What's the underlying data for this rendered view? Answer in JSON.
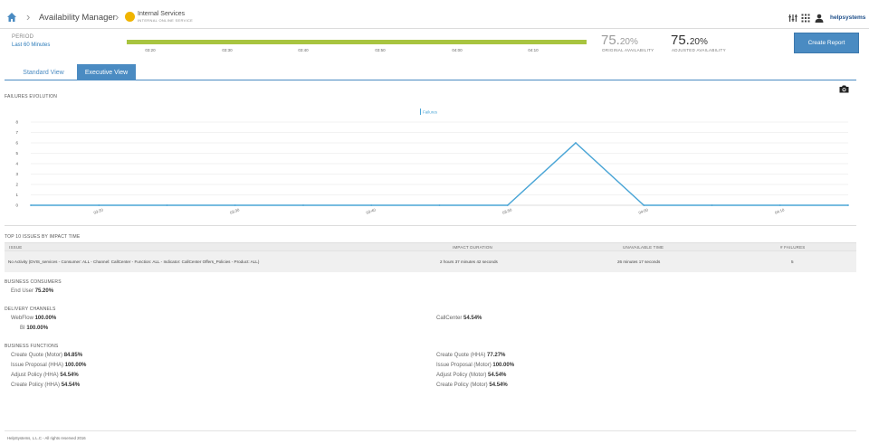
{
  "header": {
    "app_title": "Availability Manager",
    "service_title": "Internal Services",
    "service_subtitle": "INTERNAL ONLINE SERVICE",
    "brand": "helpsystems"
  },
  "period": {
    "label": "PERIOD",
    "value": "Last 60 Minutes",
    "ticks": [
      "03:20",
      "03:30",
      "03:40",
      "03:50",
      "04:00",
      "04:10"
    ]
  },
  "availability": {
    "original_value": "75.",
    "original_decimals": "20%",
    "original_label": "ORIGINAL AVAILABILITY",
    "adjusted_value": "75.",
    "adjusted_decimals": "20%",
    "adjusted_label": "ADJUSTED AVAILABILITY"
  },
  "buttons": {
    "create_report": "Create Report"
  },
  "tabs": [
    {
      "label": "Standard View",
      "active": false
    },
    {
      "label": "Executive View",
      "active": true
    }
  ],
  "sections": {
    "failures_evolution": "FAILURES EVOLUTION",
    "top_issues": "TOP 10 ISSUES BY IMPACT TIME",
    "business_consumers": "BUSINESS CONSUMERS",
    "delivery_channels": "DELIVERY CHANNELS",
    "business_functions": "BUSINESS FUNCTIONS"
  },
  "chart_data": {
    "type": "line",
    "legend": "Failures",
    "x": [
      "03:15",
      "03:20",
      "03:25",
      "03:30",
      "03:35",
      "03:40",
      "03:45",
      "03:50",
      "03:55",
      "04:00",
      "04:05",
      "04:10",
      "04:15"
    ],
    "x_tick_labels": [
      "03:20",
      "03:30",
      "03:40",
      "03:50",
      "04:00",
      "04:10"
    ],
    "series": [
      {
        "name": "Failures",
        "values": [
          0,
          0,
          0,
          0,
          0,
          0,
          0,
          0,
          6,
          0,
          0,
          0,
          0
        ]
      }
    ],
    "ylim": [
      0,
      8
    ],
    "y_ticks": [
      0,
      1,
      2,
      3,
      4,
      5,
      6,
      7,
      8
    ],
    "color": "#4aa5d6",
    "grid": true,
    "legend_position": "top-center"
  },
  "issues_table": {
    "columns": [
      "ISSUE",
      "IMPACT DURATION",
      "UNAVAILABLE TIME",
      "# FAILURES"
    ],
    "rows": [
      {
        "issue": "No Activity (DVIS_services - Consumer: ALL - Channel: CallCenter - Function: ALL - Indicator: CallCenter Offers_Policies - Product: ALL)",
        "impact_duration": "2 hours 37 minutes 42 seconds",
        "unavailable_time": "26 minutes 17 seconds",
        "failures": "5"
      }
    ]
  },
  "consumers": [
    {
      "name": "End User",
      "value": "75.20%"
    }
  ],
  "channels": [
    {
      "name": "WebFlow",
      "value": "100.00%"
    },
    {
      "name": "CallCenter",
      "value": "54.54%"
    },
    {
      "name": "BI",
      "value": "100.00%"
    }
  ],
  "functions": [
    {
      "name": "Create Quote (Motor)",
      "value": "84.85%"
    },
    {
      "name": "Create Quote (HHA)",
      "value": "77.27%"
    },
    {
      "name": "Issue Proposal (HHA)",
      "value": "100.00%"
    },
    {
      "name": "Issue Proposal (Motor)",
      "value": "100.00%"
    },
    {
      "name": "Adjust Policy (HHA)",
      "value": "54.54%"
    },
    {
      "name": "Adjust Policy (Motor)",
      "value": "54.54%"
    },
    {
      "name": "Create Policy (HHA)",
      "value": "54.54%"
    },
    {
      "name": "Create Policy (Motor)",
      "value": "54.54%"
    }
  ],
  "footer": {
    "text": "HelpSystems, L.L.C - All rights reserved 2016"
  },
  "colors": {
    "accent": "#4a8bc2",
    "period_bar": "#a8c440",
    "service_icon": "#f0b400"
  }
}
